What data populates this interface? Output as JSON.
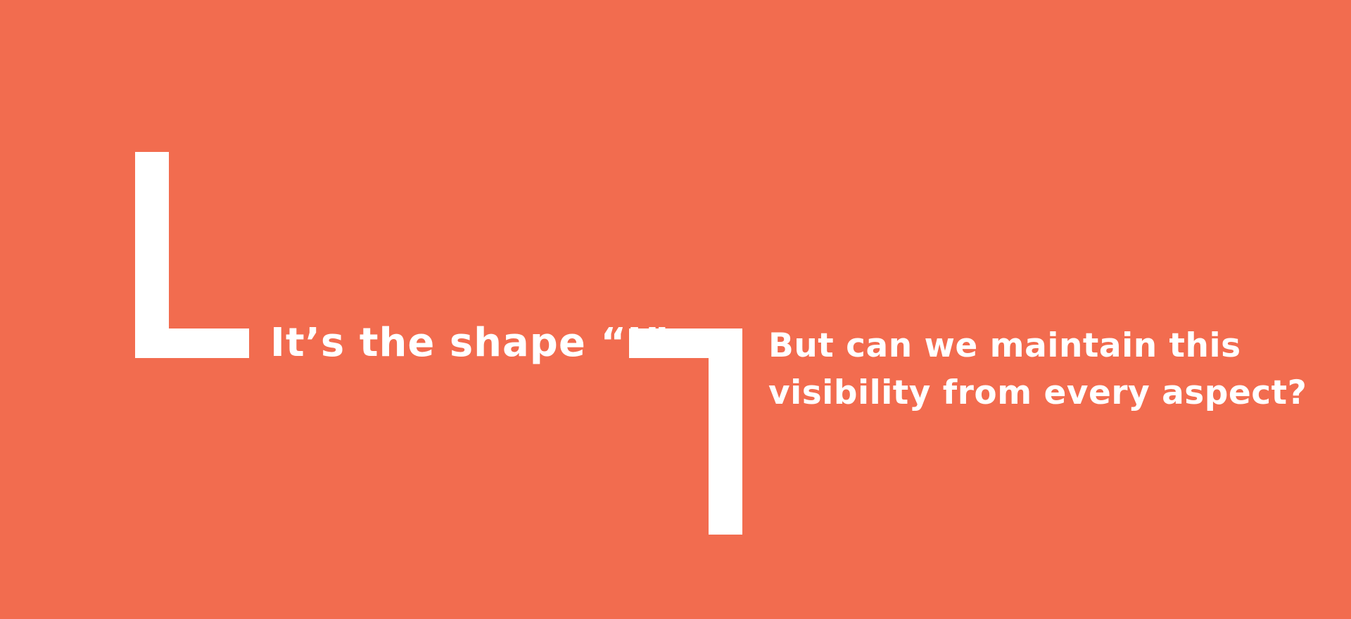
{
  "theme": {
    "background": "#F26C4F",
    "foreground": "#FFFFFF"
  },
  "slide": {
    "left_caption": "It’s the shape “L”",
    "right_caption_lines": [
      "But can we maintain this",
      "visibility from every aspect?"
    ]
  }
}
